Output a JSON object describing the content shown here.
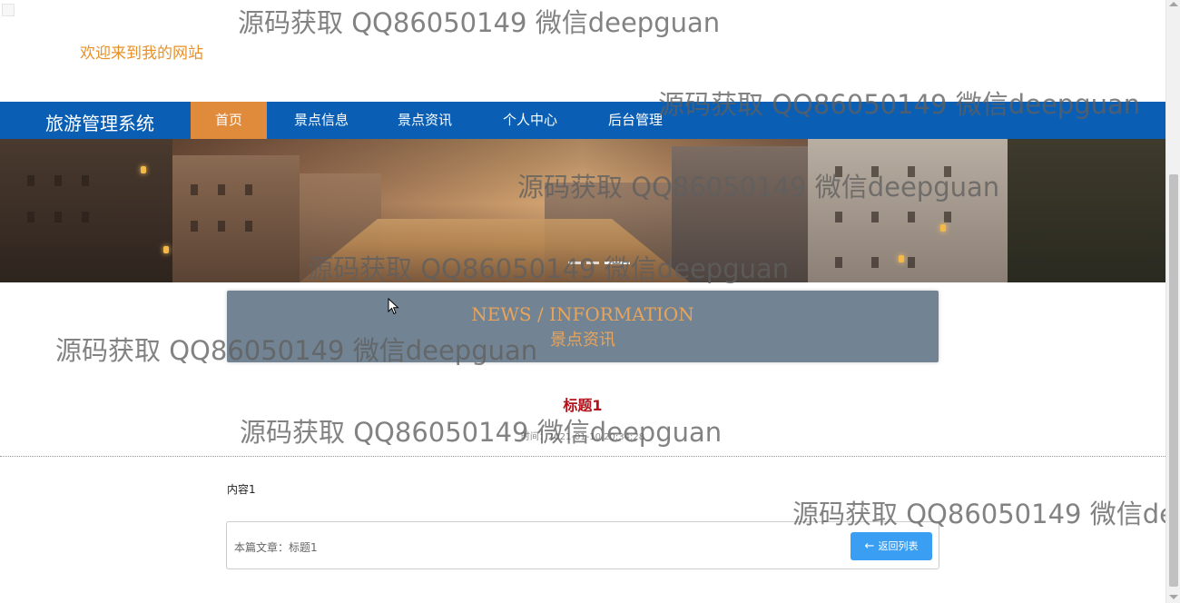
{
  "header": {
    "welcome_text": "欢迎来到我的网站"
  },
  "nav": {
    "brand": "旅游管理系统",
    "items": [
      {
        "label": "首页",
        "active": true
      },
      {
        "label": "景点信息",
        "active": false
      },
      {
        "label": "景点资讯",
        "active": false
      },
      {
        "label": "个人中心",
        "active": false
      },
      {
        "label": "后台管理",
        "active": false
      }
    ]
  },
  "banner": {
    "slide_count": 3,
    "active_slide": 2
  },
  "news_header": {
    "title_en": "NEWS / INFORMATION",
    "title_cn": "景点资讯"
  },
  "article": {
    "title": "标题1",
    "time": "时间：2021-01-10 20:34:28",
    "content": "内容1",
    "current_label": "本篇文章：标题1",
    "back_button": "返回列表"
  },
  "watermark": {
    "text": "源码获取 QQ86050149 微信deepguan"
  },
  "colors": {
    "nav_bg": "#0a5fb4",
    "nav_active": "#e08a3c",
    "accent_orange": "#e8912a",
    "title_red": "#b3121b",
    "button_blue": "#3a9ef3",
    "panel_bg": "#728494"
  }
}
